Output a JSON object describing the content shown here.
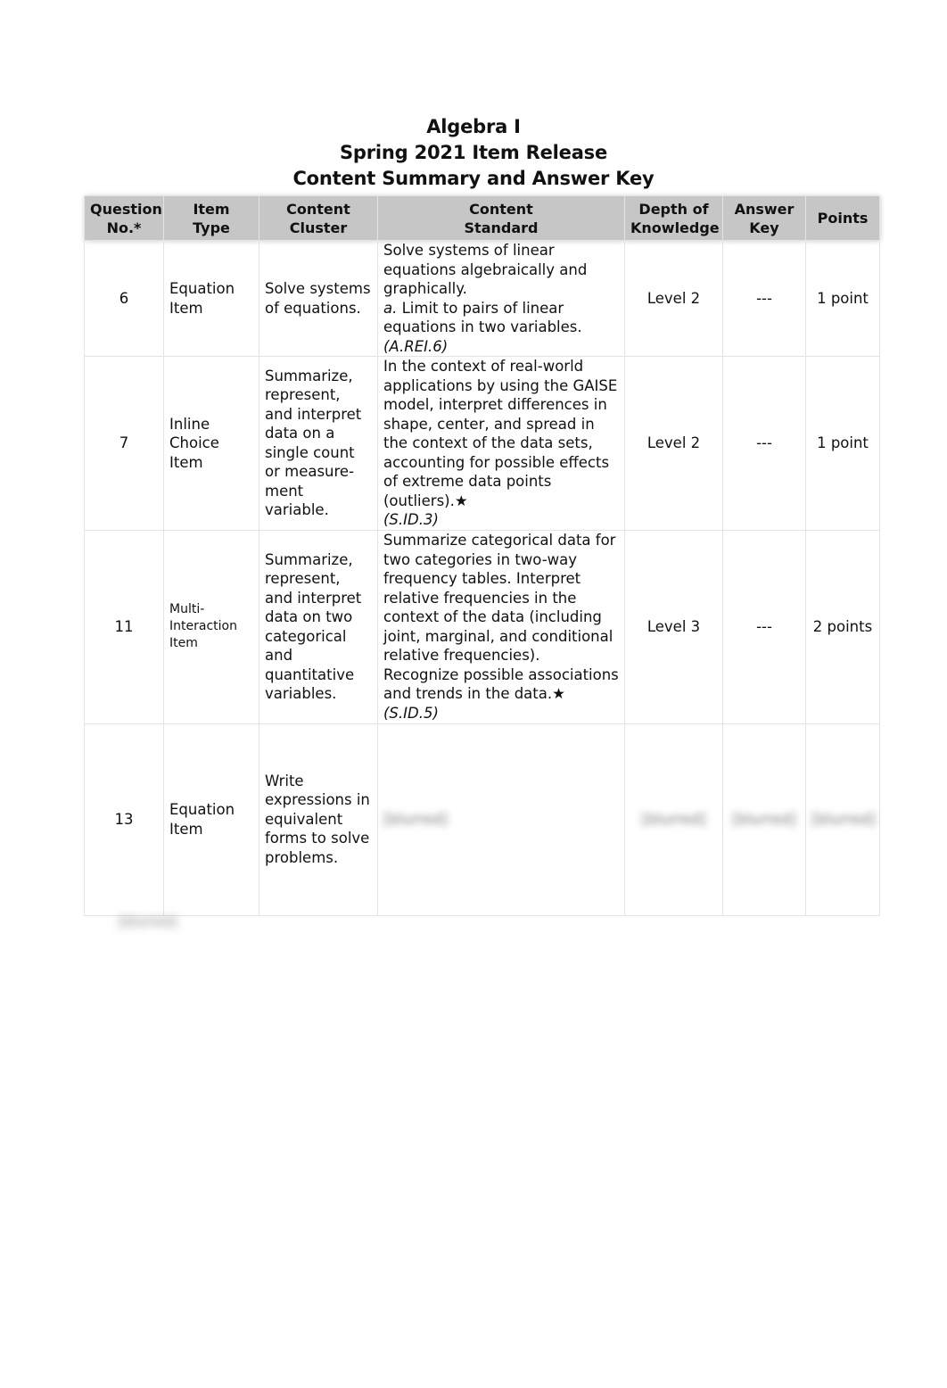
{
  "title_lines": [
    "Algebra I",
    "Spring 2021 Item Release",
    "Content Summary and Answer Key"
  ],
  "table": {
    "headers": [
      {
        "line1": "Question",
        "line2": "No.*"
      },
      {
        "line1": "Item",
        "line2": "Type"
      },
      {
        "line1": "Content",
        "line2": "Cluster"
      },
      {
        "line1": "Content",
        "line2": "Standard"
      },
      {
        "line1": "Depth of",
        "line2": "Knowledge"
      },
      {
        "line1": "Answer",
        "line2": "Key"
      },
      {
        "line1": "Points",
        "line2": ""
      }
    ],
    "rows": [
      {
        "question_no": "6",
        "item_type": "Equation Item",
        "content_cluster": "Solve systems of equations.",
        "content_standard": "Solve systems of linear equations algebraically and graphically.",
        "content_standard_sub_prefix": "a.",
        "content_standard_sub": " Limit to pairs of linear equations in two variables.",
        "content_standard_code": "(A.REI.6)",
        "depth_of_knowledge": "Level 2",
        "answer_key": "---",
        "points": "1 point"
      },
      {
        "question_no": "7",
        "item_type": "Inline Choice Item",
        "content_cluster": "Summarize, represent, and interpret data on a single count or measure-ment variable.",
        "content_standard": "In the context of real-world applications by using the GAISE model, interpret differences in shape, center, and spread in the context of the data sets, accounting for possible effects of extreme data points (outliers).★",
        "content_standard_code": "(S.ID.3)",
        "depth_of_knowledge": "Level 2",
        "answer_key": "---",
        "points": "1 point"
      },
      {
        "question_no": "11",
        "item_type": "Multi-Interaction Item",
        "content_cluster": "Summarize, represent, and interpret data on two categorical and quantitative variables.",
        "content_standard": "Summarize categorical data for two categories in two-way frequency tables. Interpret relative frequencies in the context of the data (including joint, marginal, and conditional relative frequencies). Recognize possible associations and trends in the data.★ ",
        "content_standard_code": "(S.ID.5)",
        "depth_of_knowledge": "Level 3",
        "answer_key": "---",
        "points": "2 points"
      },
      {
        "question_no": "13",
        "item_type": "Equation Item",
        "content_cluster": "Write expressions in equivalent forms to solve problems.",
        "content_standard": "[blurred]",
        "depth_of_knowledge": "[blurred]",
        "answer_key": "[blurred]",
        "points": "[blurred]"
      }
    ]
  },
  "footnote": "[blurred]"
}
